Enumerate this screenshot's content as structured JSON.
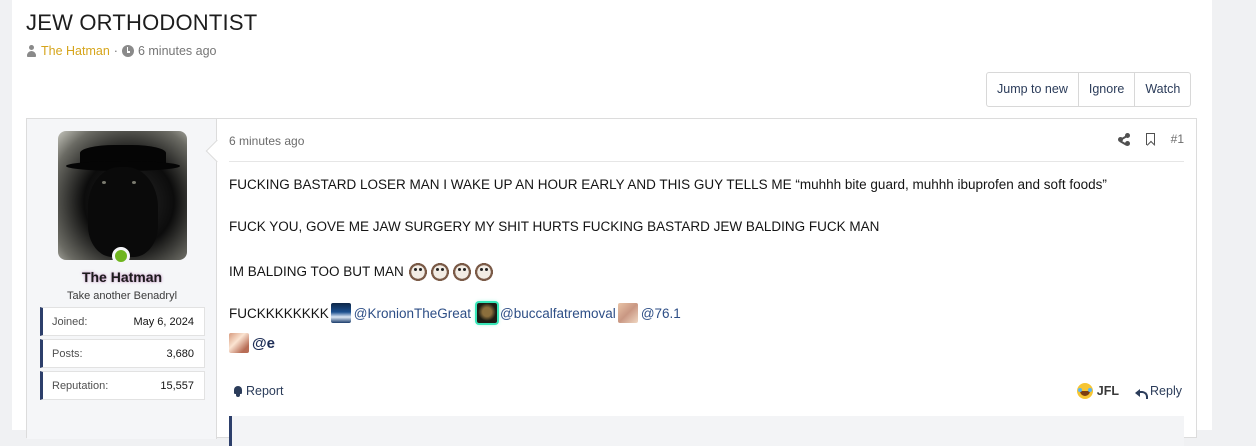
{
  "thread": {
    "title": "JEW ORTHODONTIST",
    "author": "The Hatman",
    "separator": "·",
    "time": "6 minutes ago"
  },
  "toolbar": {
    "jump_label": "Jump to new",
    "ignore_label": "Ignore",
    "watch_label": "Watch"
  },
  "user": {
    "name": "The Hatman",
    "title": "Take another Benadryl",
    "stats": [
      {
        "label": "Joined:",
        "value": "May 6, 2024"
      },
      {
        "label": "Posts:",
        "value": "3,680"
      },
      {
        "label": "Reputation:",
        "value": "15,557"
      }
    ],
    "online_color": "#6fb51f"
  },
  "post": {
    "time": "6 minutes ago",
    "number": "#1",
    "lines": [
      "FUCKING BASTARD LOSER MAN I WAKE UP AN HOUR EARLY AND THIS GUY TELLS ME “muhhh bite guard, muhhh ibuprofen and soft foods”",
      "FUCK YOU, GOVE ME JAW SURGERY MY SHIT HURTS FUCKING BASTARD JEW BALDING FUCK MAN",
      "IM BALDING TOO BUT MAN",
      "FUCKKKKKKKK"
    ],
    "mentions": [
      "@KronionTheGreat",
      "@buccalfatremoval",
      "@76.1",
      "@e"
    ],
    "report_label": "Report",
    "reaction_label": "JFL",
    "reply_label": "Reply"
  },
  "colors": {
    "accent": "#2d3f6b",
    "author": "#d6a51c",
    "link": "#2d4e86"
  }
}
